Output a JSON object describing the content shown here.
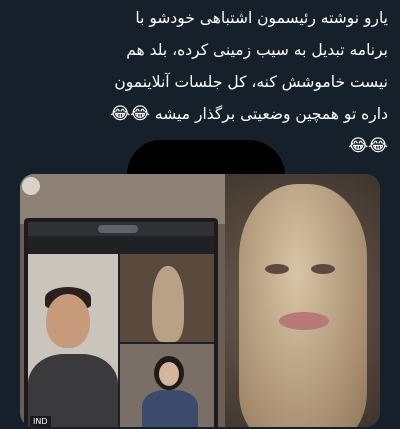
{
  "tweet": {
    "lines": [
      "یارو نوشته رئیسمون اشتباهی خودشو با",
      "برنامه تبدیل به سیب زمینی کرده، بلد هم",
      "نیست خاموشش کنه، کل جلسات آنلاینمون",
      "داره تو همچین وضعیتی برگذار میشه"
    ],
    "emoji_inline": "😂😂",
    "emoji_trailing": "😂😂",
    "emoji_line5": "😂😂"
  },
  "media": {
    "left_photo": {
      "chip_text": "IND"
    },
    "right_photo": {}
  },
  "colors": {
    "background": "#15202b",
    "text": "#ffffff"
  }
}
